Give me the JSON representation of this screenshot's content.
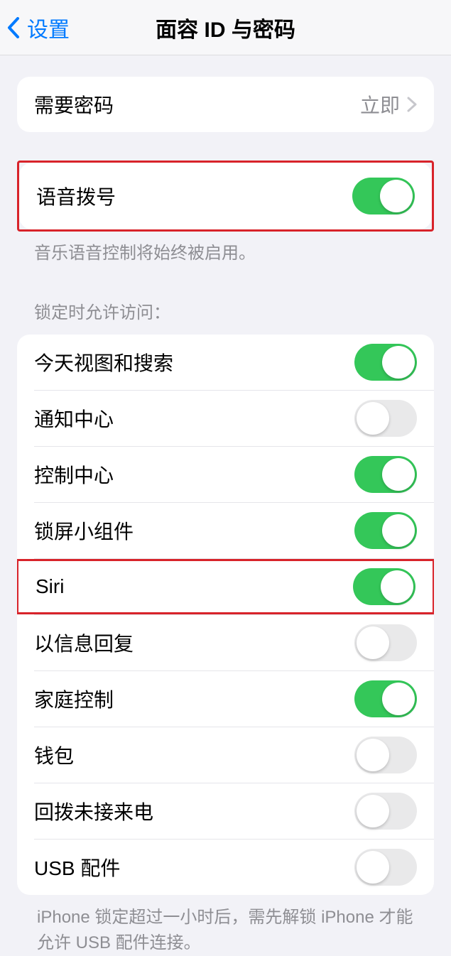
{
  "nav": {
    "back_label": "设置",
    "title": "面容 ID 与密码"
  },
  "passcode": {
    "label": "需要密码",
    "value": "立即"
  },
  "voice_dial": {
    "label": "语音拨号",
    "footer": "音乐语音控制将始终被启用。"
  },
  "locked_access": {
    "header": "锁定时允许访问：",
    "items": [
      {
        "label": "今天视图和搜索",
        "on": true
      },
      {
        "label": "通知中心",
        "on": false
      },
      {
        "label": "控制中心",
        "on": true
      },
      {
        "label": "锁屏小组件",
        "on": true
      },
      {
        "label": "Siri",
        "on": true
      },
      {
        "label": "以信息回复",
        "on": false
      },
      {
        "label": "家庭控制",
        "on": true
      },
      {
        "label": "钱包",
        "on": false
      },
      {
        "label": "回拨未接来电",
        "on": false
      },
      {
        "label": "USB 配件",
        "on": false
      }
    ],
    "footer": "iPhone 锁定超过一小时后，需先解锁 iPhone 才能允许 USB 配件连接。"
  }
}
